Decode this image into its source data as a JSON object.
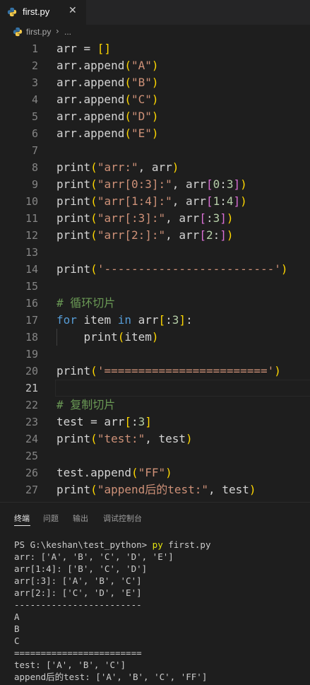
{
  "tab": {
    "filename": "first.py",
    "close_glyph": "✕"
  },
  "breadcrumb": {
    "file": "first.py",
    "separator": "›",
    "more": "..."
  },
  "editor": {
    "active_line": 21,
    "lines": [
      {
        "n": "1",
        "tokens": [
          [
            "",
            "arr = "
          ],
          [
            "p1",
            "[]"
          ]
        ]
      },
      {
        "n": "2",
        "tokens": [
          [
            "",
            "arr.append"
          ],
          [
            "p1",
            "("
          ],
          [
            "s",
            "\"A\""
          ],
          [
            "p1",
            ")"
          ]
        ]
      },
      {
        "n": "3",
        "tokens": [
          [
            "",
            "arr.append"
          ],
          [
            "p1",
            "("
          ],
          [
            "s",
            "\"B\""
          ],
          [
            "p1",
            ")"
          ]
        ]
      },
      {
        "n": "4",
        "tokens": [
          [
            "",
            "arr.append"
          ],
          [
            "p1",
            "("
          ],
          [
            "s",
            "\"C\""
          ],
          [
            "p1",
            ")"
          ]
        ]
      },
      {
        "n": "5",
        "tokens": [
          [
            "",
            "arr.append"
          ],
          [
            "p1",
            "("
          ],
          [
            "s",
            "\"D\""
          ],
          [
            "p1",
            ")"
          ]
        ]
      },
      {
        "n": "6",
        "tokens": [
          [
            "",
            "arr.append"
          ],
          [
            "p1",
            "("
          ],
          [
            "s",
            "\"E\""
          ],
          [
            "p1",
            ")"
          ]
        ]
      },
      {
        "n": "7",
        "tokens": []
      },
      {
        "n": "8",
        "tokens": [
          [
            "",
            "print"
          ],
          [
            "p1",
            "("
          ],
          [
            "s",
            "\"arr:\""
          ],
          [
            "",
            ", arr"
          ],
          [
            "p1",
            ")"
          ]
        ]
      },
      {
        "n": "9",
        "tokens": [
          [
            "",
            "print"
          ],
          [
            "p1",
            "("
          ],
          [
            "s",
            "\"arr[0:3]:\""
          ],
          [
            "",
            ", arr"
          ],
          [
            "p2",
            "["
          ],
          [
            "n",
            "0"
          ],
          [
            "",
            ":"
          ],
          [
            "n",
            "3"
          ],
          [
            "p2",
            "]"
          ],
          [
            "p1",
            ")"
          ]
        ]
      },
      {
        "n": "10",
        "tokens": [
          [
            "",
            "print"
          ],
          [
            "p1",
            "("
          ],
          [
            "s",
            "\"arr[1:4]:\""
          ],
          [
            "",
            ", arr"
          ],
          [
            "p2",
            "["
          ],
          [
            "n",
            "1"
          ],
          [
            "",
            ":"
          ],
          [
            "n",
            "4"
          ],
          [
            "p2",
            "]"
          ],
          [
            "p1",
            ")"
          ]
        ]
      },
      {
        "n": "11",
        "tokens": [
          [
            "",
            "print"
          ],
          [
            "p1",
            "("
          ],
          [
            "s",
            "\"arr[:3]:\""
          ],
          [
            "",
            ", arr"
          ],
          [
            "p2",
            "["
          ],
          [
            "",
            ":"
          ],
          [
            "n",
            "3"
          ],
          [
            "p2",
            "]"
          ],
          [
            "p1",
            ")"
          ]
        ]
      },
      {
        "n": "12",
        "tokens": [
          [
            "",
            "print"
          ],
          [
            "p1",
            "("
          ],
          [
            "s",
            "\"arr[2:]:\""
          ],
          [
            "",
            ", arr"
          ],
          [
            "p2",
            "["
          ],
          [
            "n",
            "2"
          ],
          [
            "",
            ":"
          ],
          [
            "p2",
            "]"
          ],
          [
            "p1",
            ")"
          ]
        ]
      },
      {
        "n": "13",
        "tokens": []
      },
      {
        "n": "14",
        "tokens": [
          [
            "",
            "print"
          ],
          [
            "p1",
            "("
          ],
          [
            "s",
            "'-------------------------'"
          ],
          [
            "p1",
            ")"
          ]
        ]
      },
      {
        "n": "15",
        "tokens": []
      },
      {
        "n": "16",
        "tokens": [
          [
            "c",
            "# 循环切片"
          ]
        ]
      },
      {
        "n": "17",
        "tokens": [
          [
            "k",
            "for"
          ],
          [
            "",
            " item "
          ],
          [
            "k",
            "in"
          ],
          [
            "",
            " arr"
          ],
          [
            "p1",
            "["
          ],
          [
            "",
            ":"
          ],
          [
            "n",
            "3"
          ],
          [
            "p1",
            "]"
          ],
          [
            "",
            ":"
          ]
        ]
      },
      {
        "n": "18",
        "tokens": [
          [
            "",
            "    print"
          ],
          [
            "p1",
            "("
          ],
          [
            "",
            "item"
          ],
          [
            "p1",
            ")"
          ]
        ]
      },
      {
        "n": "19",
        "tokens": []
      },
      {
        "n": "20",
        "tokens": [
          [
            "",
            "print"
          ],
          [
            "p1",
            "("
          ],
          [
            "s",
            "'========================'"
          ],
          [
            "p1",
            ")"
          ]
        ]
      },
      {
        "n": "21",
        "tokens": []
      },
      {
        "n": "22",
        "tokens": [
          [
            "c",
            "# 复制切片"
          ]
        ]
      },
      {
        "n": "23",
        "tokens": [
          [
            "",
            "test = arr"
          ],
          [
            "p1",
            "["
          ],
          [
            "",
            ":"
          ],
          [
            "n",
            "3"
          ],
          [
            "p1",
            "]"
          ]
        ]
      },
      {
        "n": "24",
        "tokens": [
          [
            "",
            "print"
          ],
          [
            "p1",
            "("
          ],
          [
            "s",
            "\"test:\""
          ],
          [
            "",
            ", test"
          ],
          [
            "p1",
            ")"
          ]
        ]
      },
      {
        "n": "25",
        "tokens": []
      },
      {
        "n": "26",
        "tokens": [
          [
            "",
            "test.append"
          ],
          [
            "p1",
            "("
          ],
          [
            "s",
            "\"FF\""
          ],
          [
            "p1",
            ")"
          ]
        ]
      },
      {
        "n": "27",
        "tokens": [
          [
            "",
            "print"
          ],
          [
            "p1",
            "("
          ],
          [
            "s",
            "\"append后的test:\""
          ],
          [
            "",
            ", test"
          ],
          [
            "p1",
            ")"
          ]
        ]
      }
    ]
  },
  "panel": {
    "tabs": [
      "终端",
      "问题",
      "输出",
      "调试控制台"
    ],
    "active_tab": 0,
    "prompt": "PS G:\\keshan\\test_python> ",
    "command": "py",
    "command_args": " first.py",
    "output": [
      "arr: ['A', 'B', 'C', 'D', 'E']",
      "arr[1:4]: ['B', 'C', 'D']",
      "arr[:3]: ['A', 'B', 'C']",
      "arr[2:]: ['C', 'D', 'E']",
      "------------------------",
      "A",
      "B",
      "C",
      "========================",
      "test: ['A', 'B', 'C']",
      "append后的test: ['A', 'B', 'C', 'FF']"
    ]
  },
  "colors": {
    "editor_bg": "#1e1e1e",
    "keyword": "#569cd6",
    "string": "#ce9178",
    "comment": "#6a9955",
    "number": "#b5cea8",
    "bracket_level1": "#ffd700",
    "bracket_level2": "#da70d6",
    "terminal_command": "#e5e510"
  },
  "icons": {
    "file_icon": "python-file-icon"
  }
}
